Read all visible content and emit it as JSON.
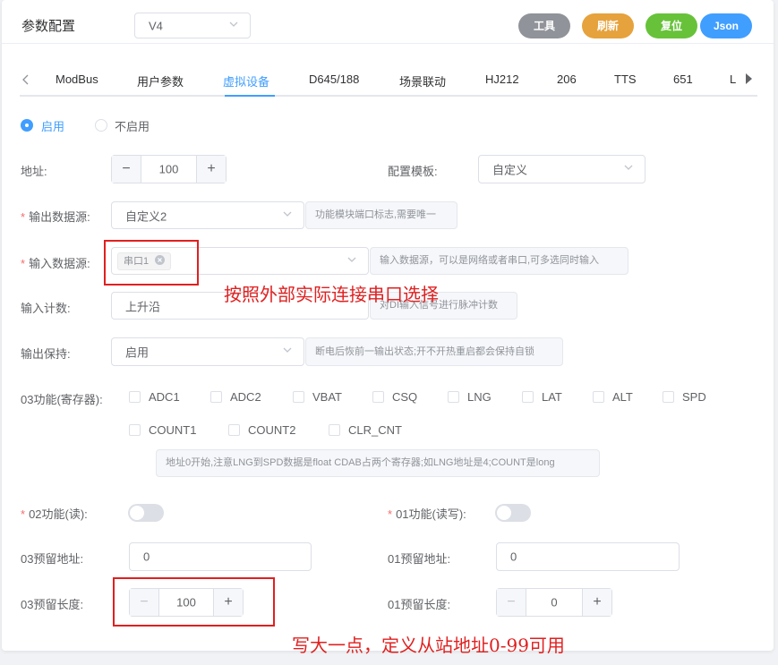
{
  "header": {
    "title": "参数配置",
    "version_value": "V4",
    "buttons": [
      {
        "label": "工具",
        "color": "#909399"
      },
      {
        "label": "刷新",
        "color": "#e6a23c"
      },
      {
        "label": "复位",
        "color": "#67c23a"
      },
      {
        "label": "Json",
        "color": "#409eff"
      }
    ]
  },
  "tabs": {
    "items": [
      "ModBus",
      "用户参数",
      "虚拟设备",
      "D645/188",
      "场景联动",
      "HJ212",
      "206",
      "TTS",
      "651",
      "L"
    ],
    "active": "虚拟设备"
  },
  "radio": {
    "enabled_label": "启用",
    "disabled_label": "不启用",
    "selected": "启用"
  },
  "form": {
    "address": {
      "label": "地址:",
      "value": "100"
    },
    "template": {
      "label": "配置模板:",
      "value": "自定义"
    },
    "output_source": {
      "label": "输出数据源:",
      "value": "自定义2",
      "hint": "功能模块端口标志,需要唯一"
    },
    "input_source": {
      "label": "输入数据源:",
      "tag": "串口1",
      "hint": "输入数据源，可以是网络或者串口,可多选同时输入"
    },
    "input_count": {
      "label": "输入计数:",
      "value": "上升沿",
      "hint": "对DI输入信号进行脉冲计数"
    },
    "output_hold": {
      "label": "输出保持:",
      "value": "启用",
      "hint": "断电后恢前一输出状态;开不开热重启都会保持自锁"
    },
    "func03": {
      "label": "03功能(寄存器):",
      "options": [
        "ADC1",
        "ADC2",
        "VBAT",
        "CSQ",
        "LNG",
        "LAT",
        "ALT",
        "SPD",
        "COUNT1",
        "COUNT2",
        "CLR_CNT"
      ],
      "hint": "地址0开始,注意LNG到SPD数据是float CDAB占两个寄存器;如LNG地址是4;COUNT是long"
    },
    "func02": {
      "label": "02功能(读):"
    },
    "func01": {
      "label": "01功能(读写):"
    },
    "reserve03_addr": {
      "label": "03预留地址:",
      "value": "0"
    },
    "reserve01_addr": {
      "label": "01预留地址:",
      "value": "0"
    },
    "reserve03_len": {
      "label": "03预留长度:",
      "value": "100"
    },
    "reserve01_len": {
      "label": "01预留长度:",
      "value": "0"
    }
  },
  "annotations": {
    "note1": "按照外部实际连接串口选择",
    "note2": "写大一点，定义从站地址0-99可用",
    "color": "#e02020"
  },
  "controls": {
    "minus": "−",
    "plus": "+"
  }
}
